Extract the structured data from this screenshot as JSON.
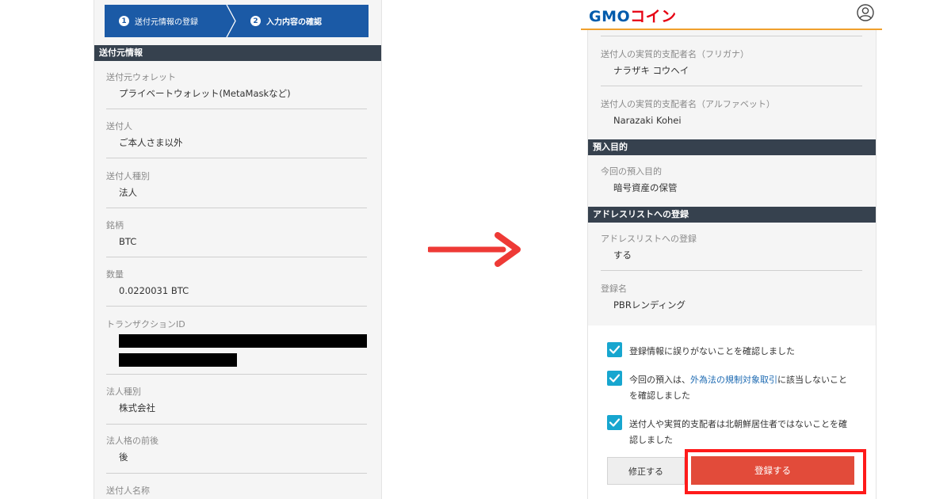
{
  "left": {
    "steps": [
      {
        "num": "1",
        "label": "送付元情報の登録"
      },
      {
        "num": "2",
        "label": "入力内容の確認"
      }
    ],
    "section_title": "送付元情報",
    "fields": [
      {
        "label": "送付元ウォレット",
        "value": "プライベートウォレット(MetaMaskなど)"
      },
      {
        "label": "送付人",
        "value": "ご本人さま以外"
      },
      {
        "label": "送付人種別",
        "value": "法人"
      },
      {
        "label": "銘柄",
        "value": "BTC"
      },
      {
        "label": "数量",
        "value": "0.0220031 BTC"
      },
      {
        "label": "トランザクションID",
        "value": ""
      },
      {
        "label": "法人種別",
        "value": "株式会社"
      },
      {
        "label": "法人格の前後",
        "value": "後"
      },
      {
        "label": "送付人名称",
        "value": ""
      }
    ]
  },
  "right": {
    "logo": {
      "gmo": "GMO",
      "coin": "コイン"
    },
    "fields_top": [
      {
        "label": "送付人の実質的支配者名（フリガナ）",
        "value": "ナラザキ コウヘイ"
      },
      {
        "label": "送付人の実質的支配者名（アルファベット）",
        "value": "Narazaki Kohei"
      }
    ],
    "section_purpose": "預入目的",
    "purpose_field": {
      "label": "今回の預入目的",
      "value": "暗号資産の保管"
    },
    "section_address": "アドレスリストへの登録",
    "address_fields": [
      {
        "label": "アドレスリストへの登録",
        "value": "する"
      },
      {
        "label": "登録名",
        "value": "PBRレンディング"
      }
    ],
    "checks": [
      {
        "text": "登録情報に誤りがないことを確認しました"
      },
      {
        "text_before": "今回の預入は、",
        "link": "外為法の規制対象取引",
        "text_after": "に該当しないことを確認しました"
      },
      {
        "text": "送付人や実質的支配者は北朝鮮居住者ではないことを確認しました"
      }
    ],
    "edit_button": "修正する",
    "register_button": "登録する"
  },
  "colors": {
    "stepper_blue": "#1b5aa6",
    "section_header": "#36414e",
    "topbar_accent": "#f0a02c",
    "checkbox": "#17a6cf",
    "register_button": "#e24b3a",
    "highlight": "#ff1a1a",
    "arrow": "#ee3a36"
  }
}
